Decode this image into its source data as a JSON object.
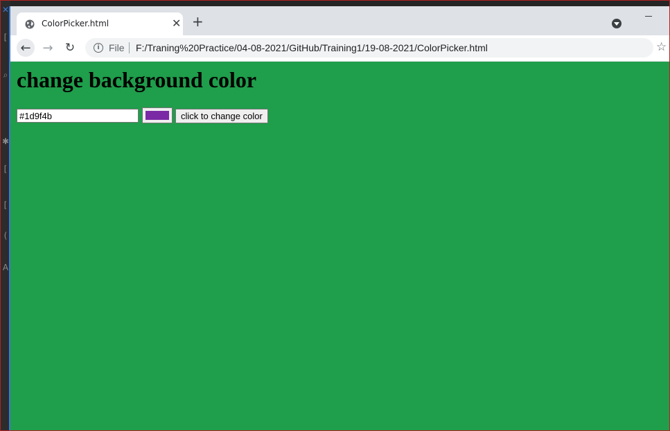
{
  "browser": {
    "tab_title": "ColorPicker.html",
    "close_glyph": "✕",
    "new_tab_glyph": "+",
    "address": {
      "scheme_label": "File",
      "url": "F:/Traning%20Practice/04-08-2021/GitHub/Training1/19-08-2021/ColorPicker.html"
    },
    "nav": {
      "back_glyph": "←",
      "forward_glyph": "→",
      "reload_glyph": "↻",
      "star_glyph": "☆",
      "info_glyph": "i"
    }
  },
  "page": {
    "heading": "change background color",
    "color_input_value": "#1d9f4b",
    "swatch_color": "#7b2aa6",
    "button_label": "click to change color",
    "background_color": "#1f9e4b"
  },
  "colors": {
    "chrome_bg": "#dee1e6",
    "page_bg": "#1f9e4b"
  },
  "icons": {
    "tab_favicon": "globe-icon",
    "tab_close": "close-icon",
    "new_tab": "plus-icon",
    "tab_search": "dropdown-icon",
    "minimize": "minimize-icon",
    "back": "arrow-left-icon",
    "forward": "arrow-right-icon",
    "reload": "reload-icon",
    "info": "info-icon",
    "bookmark": "star-icon"
  }
}
